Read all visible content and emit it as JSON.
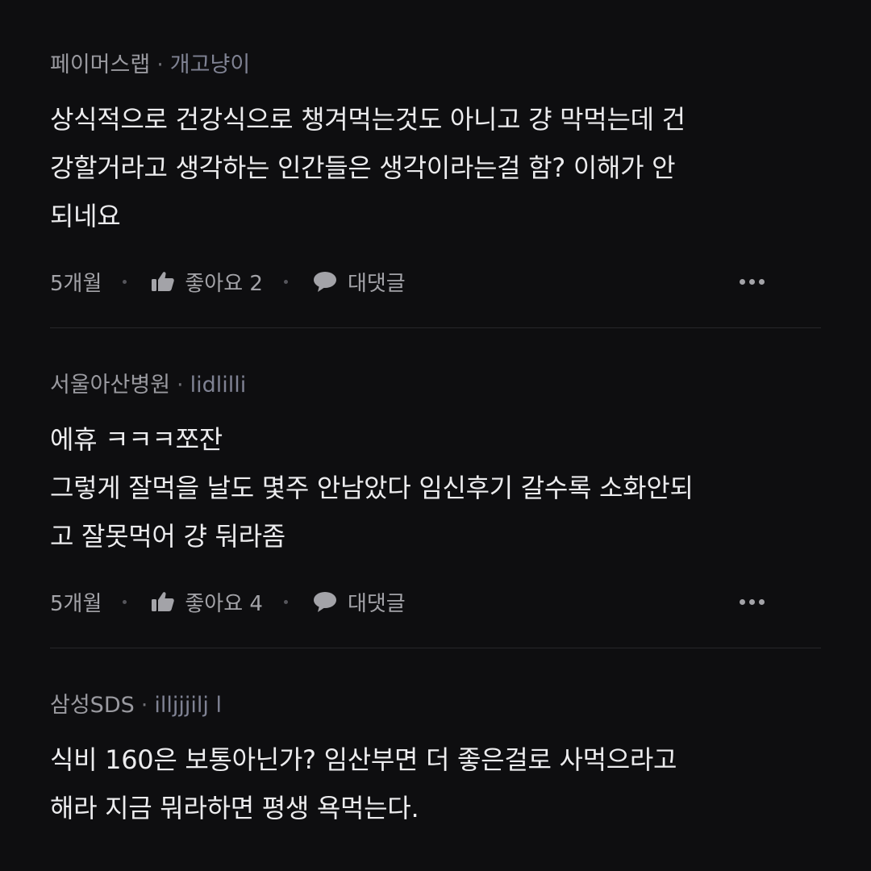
{
  "comments": [
    {
      "company": "페이머스랩",
      "separator": "·",
      "nickname": "개고냥이",
      "body": "상식적으로 건강식으로 챙겨먹는것도 아니고 걍 막먹는데 건\n강할거라고 생각하는 인간들은 생각이라는걸 함? 이해가 안\n되네요",
      "time": "5개월",
      "like_label": "좋아요 2",
      "reply_label": "대댓글"
    },
    {
      "company": "서울아산병원",
      "separator": "·",
      "nickname": "lidlilli",
      "body": "에휴 ㅋㅋㅋ쪼잔\n그렇게 잘먹을 날도 몇주 안남았다 임신후기 갈수록 소화안되\n고 잘못먹어 걍 둬라좀",
      "time": "5개월",
      "like_label": "좋아요 4",
      "reply_label": "대댓글"
    },
    {
      "company": "삼성SDS",
      "separator": "·",
      "nickname": "illjjjilj l",
      "body": "식비 160은 보통아닌가? 임산부면 더 좋은걸로 사먹으라고\n해라 지금 뭐라하면 평생 욕먹는다."
    }
  ],
  "icons": {
    "like": "thumbs-up-icon",
    "reply": "speech-bubble-icon",
    "more": "more-dots-icon"
  },
  "colors": {
    "background": "#0e0e10",
    "body_text": "#ececee",
    "meta_text": "#9a9aa0",
    "nickname": "#7f8293"
  }
}
